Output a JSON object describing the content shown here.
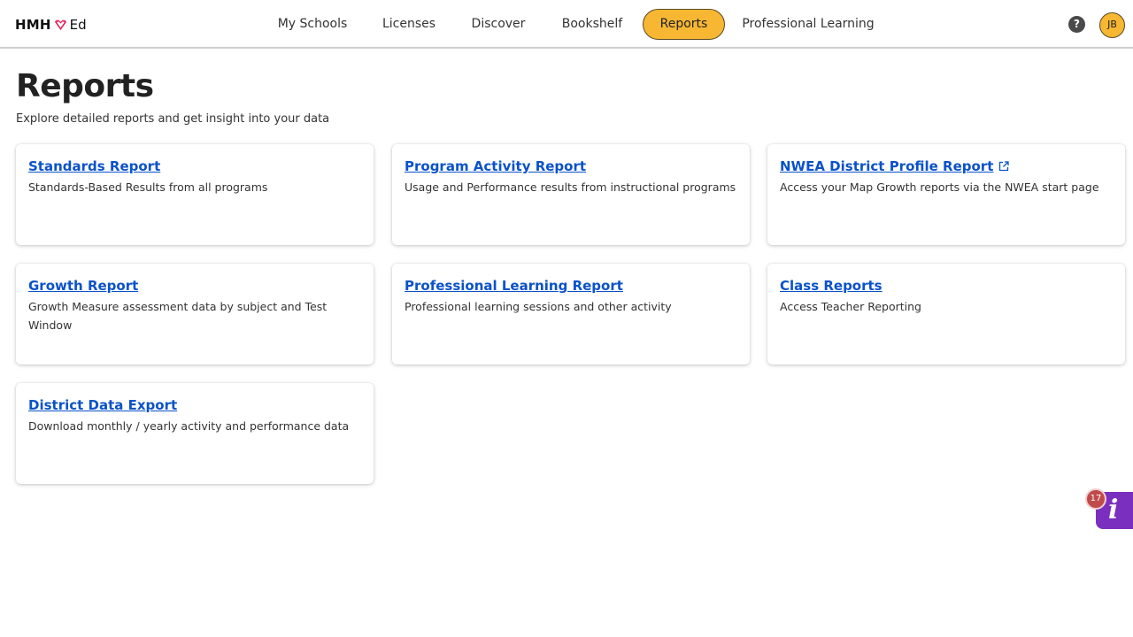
{
  "brand": {
    "name_bold": "HMH",
    "name_suffix": "Ed"
  },
  "nav": {
    "items": [
      {
        "label": "My Schools"
      },
      {
        "label": "Licenses"
      },
      {
        "label": "Discover"
      },
      {
        "label": "Bookshelf"
      },
      {
        "label": "Reports",
        "active": true
      },
      {
        "label": "Professional Learning"
      }
    ]
  },
  "header": {
    "help_glyph": "?",
    "avatar_initials": "JB"
  },
  "page": {
    "title": "Reports",
    "subtitle": "Explore detailed reports and get insight into your data"
  },
  "cards": [
    {
      "title": "Standards Report",
      "description": "Standards-Based Results from all programs"
    },
    {
      "title": "Program Activity Report",
      "description": "Usage and Performance results from instructional programs"
    },
    {
      "title": "NWEA District Profile Report",
      "description": "Access your Map Growth reports via the NWEA start page",
      "external": true
    },
    {
      "title": "Growth Report",
      "description": "Growth Measure assessment data by subject and Test Window"
    },
    {
      "title": "Professional Learning Report",
      "description": "Professional learning sessions and other activity"
    },
    {
      "title": "Class Reports",
      "description": "Access Teacher Reporting"
    },
    {
      "title": "District Data Export",
      "description": "Download monthly / yearly activity and performance data"
    }
  ],
  "info_widget": {
    "glyph": "i",
    "badge_count": "17"
  },
  "colors": {
    "accent": "#f7b733",
    "link": "#0a52c9",
    "widget": "#7b2fbf",
    "badge": "#c04a4a"
  },
  "icons": {
    "logo": "heart-logo-icon",
    "help": "help-icon",
    "external_link": "external-link-icon",
    "info": "info-icon"
  }
}
